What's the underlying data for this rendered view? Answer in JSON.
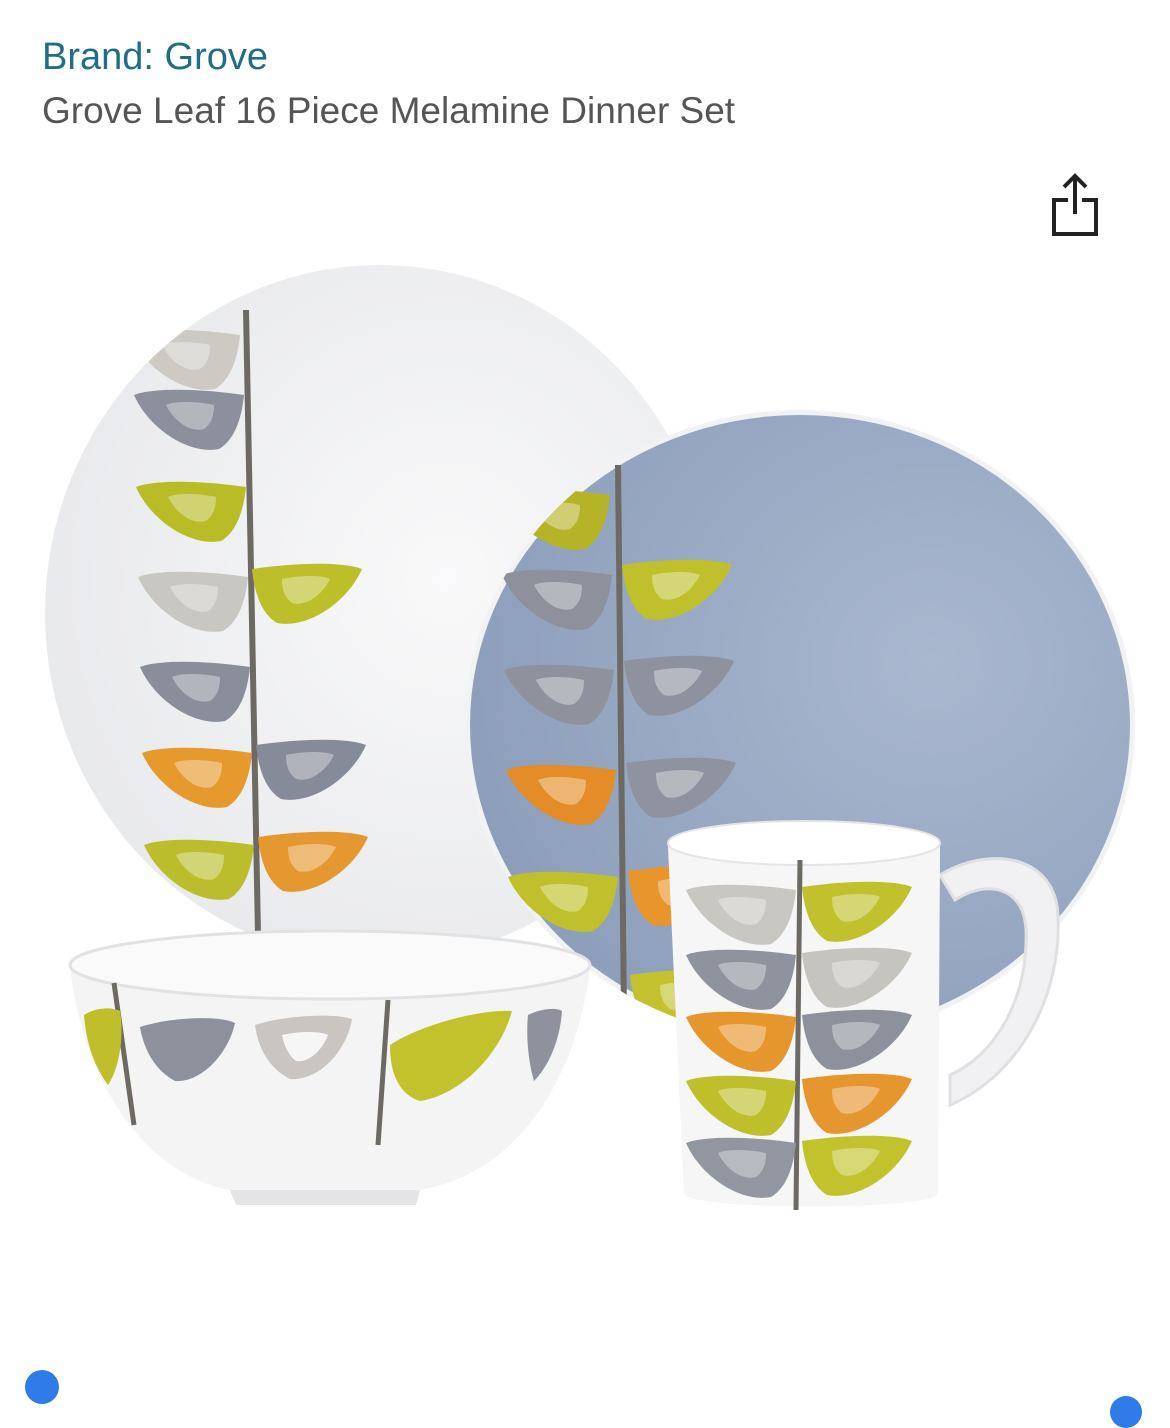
{
  "product": {
    "brand_link": "Brand: Grove",
    "title": "Grove Leaf 16 Piece Melamine Dinner Set"
  },
  "icons": {
    "share": "share-icon"
  },
  "image": {
    "alt": "Grove Leaf melamine dinner set: white dinner plate, blue side plate, bowl and mug with leaf pattern"
  },
  "carousel": {
    "indicators": 2
  },
  "colors": {
    "brand_link": "#1f6e86",
    "title": "#555555",
    "indicator": "#2f7be8",
    "plate_blue": "#9eafc8",
    "leaf_lime": "#c2c42b",
    "leaf_orange": "#e9982a",
    "leaf_grey": "#8e93a1"
  }
}
